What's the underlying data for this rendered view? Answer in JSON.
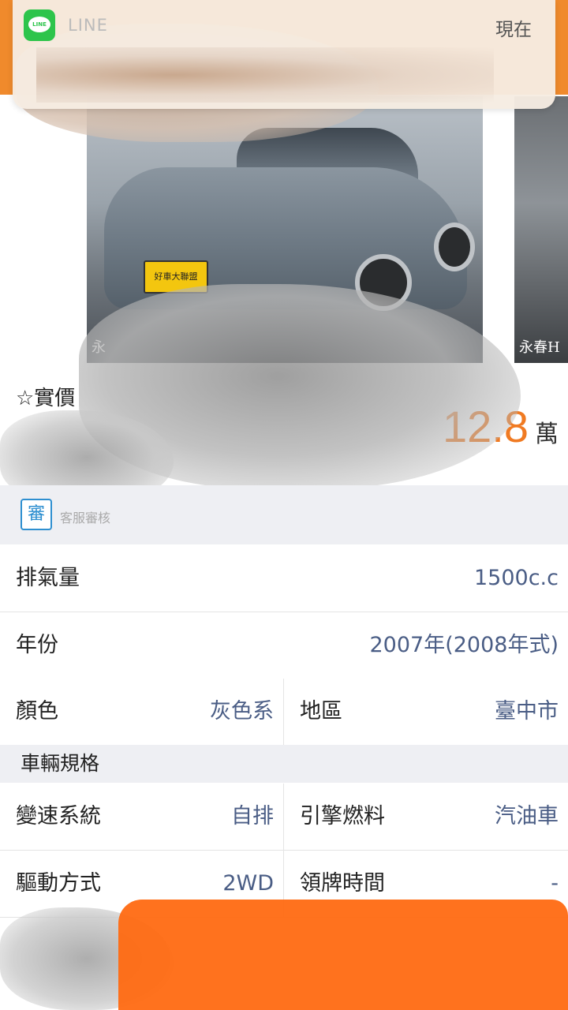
{
  "notification": {
    "app": "LINE",
    "time": "現在"
  },
  "photos": {
    "watermark_main": "永",
    "watermark_next": "永春H",
    "plate_text": "好車大聯盟"
  },
  "listing": {
    "title_visible": "☆實價",
    "price_value": "12.8",
    "price_unit": "萬"
  },
  "review": {
    "icon_glyph": "審",
    "label": "客服審核"
  },
  "specs": {
    "displacement": {
      "label": "排氣量",
      "value": "1500c.c"
    },
    "year": {
      "label": "年份",
      "value": "2007年(2008年式)"
    },
    "color": {
      "label": "顏色",
      "value": "灰色系"
    },
    "region": {
      "label": "地區",
      "value": "臺中市"
    }
  },
  "vehicle_spec_section": {
    "title": "車輛規格",
    "transmission": {
      "label": "變速系統",
      "value": "自排"
    },
    "fuel": {
      "label": "引擎燃料",
      "value": "汽油車"
    },
    "drive": {
      "label": "驅動方式",
      "value": "2WD"
    },
    "registration": {
      "label": "領牌時間",
      "value": "-"
    }
  },
  "colors": {
    "accent": "#f07a22",
    "value_text": "#4a5d85",
    "line_green": "#2dc44b",
    "badge_blue": "#2e8fd0"
  }
}
